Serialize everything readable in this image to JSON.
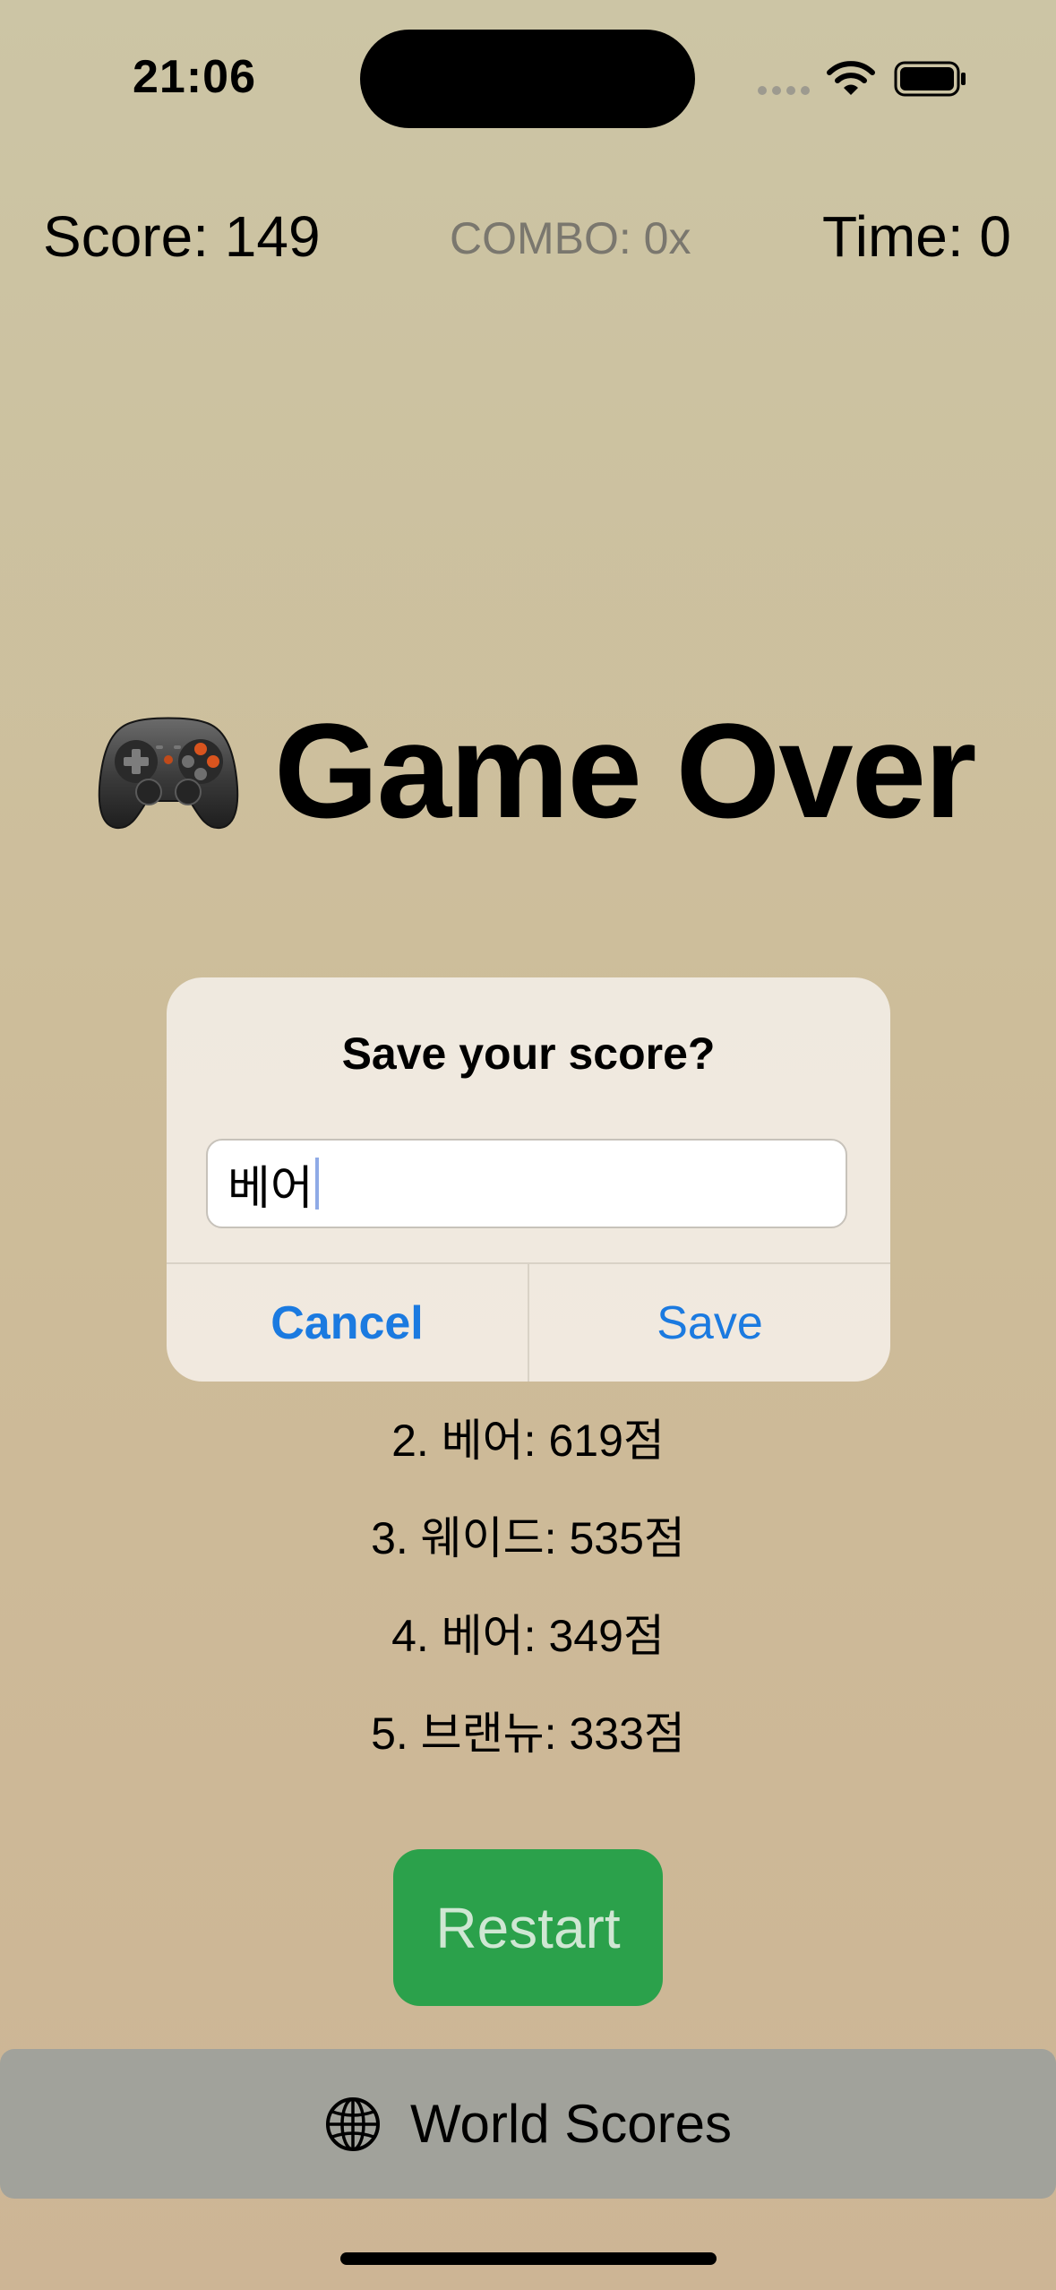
{
  "status_bar": {
    "time": "21:06",
    "icons": [
      "signal-dots-icon",
      "wifi-icon",
      "battery-icon"
    ]
  },
  "hud": {
    "score": "Score: 149",
    "combo": "COMBO: 0x",
    "time": "Time: 0"
  },
  "title": {
    "icon": "gamepad-icon",
    "text": "Game Over"
  },
  "alert": {
    "title": "Save your score?",
    "input_value": "베어",
    "cancel_label": "Cancel",
    "save_label": "Save"
  },
  "leaderboard": {
    "rows": [
      "2. 베어: 619점",
      "3. 웨이드: 535점",
      "4. 베어: 349점",
      "5. 브랜뉴: 333점"
    ]
  },
  "restart_label": "Restart",
  "world_scores": {
    "icon": "globe-icon",
    "label": "World Scores"
  },
  "colors": {
    "accent_blue": "#1b7ae0",
    "restart_green": "#2ba14b",
    "world_bar_gray": "#a1a29b",
    "combo_gray": "#7a776e"
  }
}
